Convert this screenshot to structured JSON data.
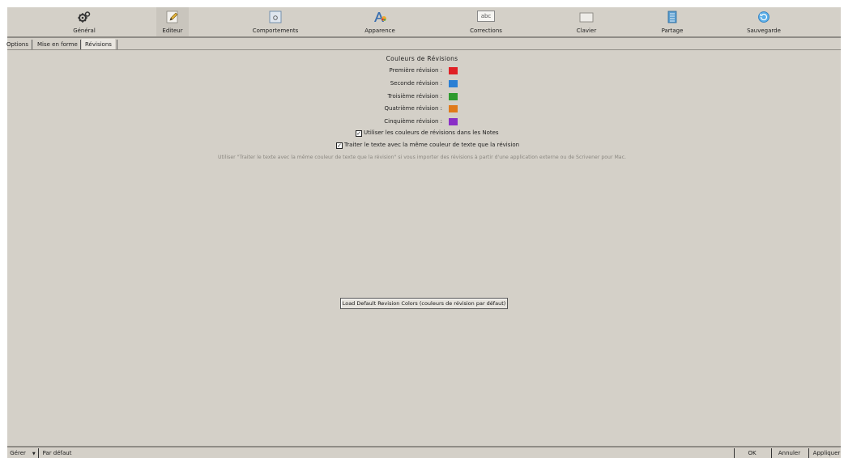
{
  "toolbar": {
    "items": [
      {
        "label": "Général",
        "icon": "gears-icon"
      },
      {
        "label": "Editeur",
        "icon": "pencil-icon"
      },
      {
        "label": "Comportements",
        "icon": "window-icon"
      },
      {
        "label": "Apparence",
        "icon": "font-color-icon"
      },
      {
        "label": "Corrections",
        "icon": "abc-icon"
      },
      {
        "label": "Clavier",
        "icon": "keyboard-icon"
      },
      {
        "label": "Partage",
        "icon": "share-icon"
      },
      {
        "label": "Sauvegarde",
        "icon": "backup-icon"
      }
    ],
    "abc_text": "abc",
    "selected": "Editeur"
  },
  "tabs": {
    "items": [
      {
        "label": "Options"
      },
      {
        "label": "Mise en forme"
      },
      {
        "label": "Révisions"
      }
    ],
    "active": "Révisions"
  },
  "revisions": {
    "title": "Couleurs de Révisions",
    "rows": [
      {
        "label": "Première révision :",
        "color": "#e01f24"
      },
      {
        "label": "Seconde révision :",
        "color": "#2a7fd4"
      },
      {
        "label": "Troisième révision :",
        "color": "#2e9a2e"
      },
      {
        "label": "Quatrième révision :",
        "color": "#e07a1a"
      },
      {
        "label": "Cinquième révision :",
        "color": "#8a2fc7"
      }
    ],
    "checkboxes": [
      {
        "label": "Utiliser les couleurs de révisions dans les Notes",
        "checked": true
      },
      {
        "label": "Traiter le texte avec la même couleur de texte que la révision",
        "checked": true
      }
    ],
    "hint": "Utiliser \"Traiter le texte avec la même couleur de texte que la révision\" si vous importer des révisions à partir d'une application externe ou de Scrivener pour Mac.",
    "load_button": "Load Default Revision Colors (couleurs de révision par défaut)"
  },
  "bottom": {
    "gerer": "Gérer",
    "par_defaut": "Par défaut",
    "ok": "OK",
    "annuler": "Annuler",
    "appliquer": "Appliquer"
  }
}
